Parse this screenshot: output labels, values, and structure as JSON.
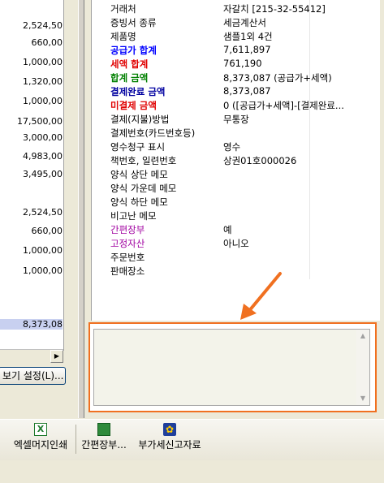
{
  "left_grid": {
    "amounts": [
      "2,524,50",
      "660,00",
      "1,000,00",
      "1,320,00",
      "1,000,00",
      "17,500,00",
      "3,000,00",
      "4,983,00",
      "3,495,00",
      "2,524,50",
      "660,00",
      "1,000,00",
      "1,000,00",
      "8,373,08"
    ],
    "view_settings_button": "보기 설정(L)..."
  },
  "properties": [
    {
      "key": "거래처",
      "value": "자갈치 [215-32-55412]",
      "style": ""
    },
    {
      "key": "증빙서 종류",
      "value": "세금계산서",
      "style": ""
    },
    {
      "key": "제품명",
      "value": "샘플1외 4건",
      "style": ""
    },
    {
      "key": "공급가 합계",
      "value": "7,611,897",
      "style": "blue"
    },
    {
      "key": "세액 합계",
      "value": "761,190",
      "style": "red"
    },
    {
      "key": "합계 금액",
      "value": "8,373,087 (공급가+세액)",
      "style": "green"
    },
    {
      "key": "결제완료 금액",
      "value": "8,373,087",
      "style": "navy"
    },
    {
      "key": "미결제 금액",
      "value": "0 ([공급가+세액]-[결제완료...",
      "style": "red"
    },
    {
      "key": "결제(지불)방법",
      "value": "무통장",
      "style": ""
    },
    {
      "key": "결제번호(카드번호등)",
      "value": "",
      "style": ""
    },
    {
      "key": "영수청구 표시",
      "value": "영수",
      "style": ""
    },
    {
      "key": "책번호, 일련번호",
      "value": "상권01호000026",
      "style": ""
    },
    {
      "key": "양식 상단 메모",
      "value": "",
      "style": ""
    },
    {
      "key": "양식 가운데 메모",
      "value": "",
      "style": ""
    },
    {
      "key": "양식 하단 메모",
      "value": "",
      "style": ""
    },
    {
      "key": "비고난 메모",
      "value": "",
      "style": ""
    },
    {
      "key": "간편장부",
      "value": "예",
      "style": "purple"
    },
    {
      "key": "고정자산",
      "value": "아니오",
      "style": "purple"
    },
    {
      "key": "주문번호",
      "value": "",
      "style": ""
    },
    {
      "key": "판매장소",
      "value": "",
      "style": ""
    }
  ],
  "memo": {
    "value": ""
  },
  "toolbar": {
    "excel_label": "엑셀머지인쇄",
    "simple_ledger_label": "간편장부...",
    "vat_report_label": "부가세신고자료"
  },
  "colors": {
    "highlight_frame": "#f07020",
    "annotation_arrow": "#f07020"
  }
}
